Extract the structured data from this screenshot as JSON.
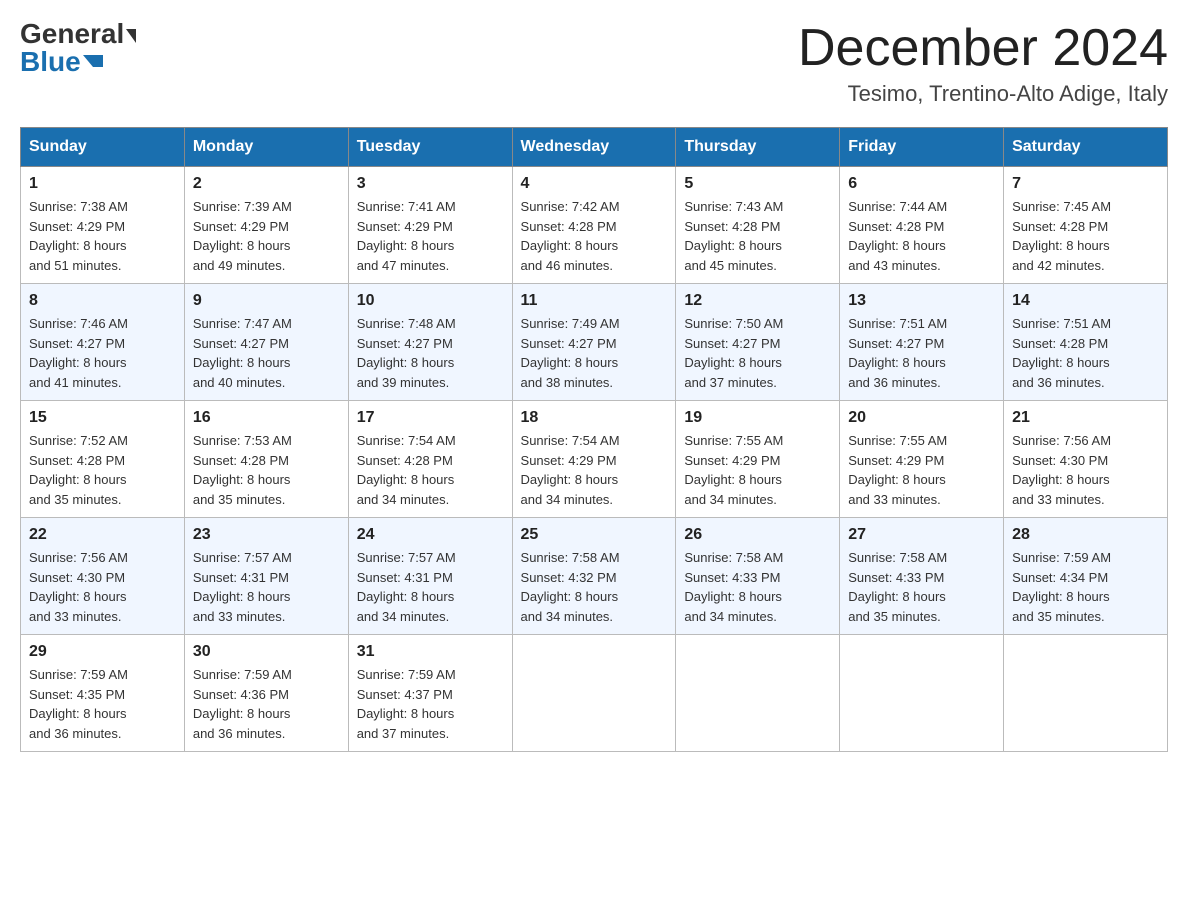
{
  "header": {
    "logo_general": "General",
    "logo_blue": "Blue",
    "month_title": "December 2024",
    "subtitle": "Tesimo, Trentino-Alto Adige, Italy"
  },
  "weekdays": [
    "Sunday",
    "Monday",
    "Tuesday",
    "Wednesday",
    "Thursday",
    "Friday",
    "Saturday"
  ],
  "weeks": [
    [
      {
        "day": "1",
        "sunrise": "7:38 AM",
        "sunset": "4:29 PM",
        "daylight": "8 hours and 51 minutes."
      },
      {
        "day": "2",
        "sunrise": "7:39 AM",
        "sunset": "4:29 PM",
        "daylight": "8 hours and 49 minutes."
      },
      {
        "day": "3",
        "sunrise": "7:41 AM",
        "sunset": "4:29 PM",
        "daylight": "8 hours and 47 minutes."
      },
      {
        "day": "4",
        "sunrise": "7:42 AM",
        "sunset": "4:28 PM",
        "daylight": "8 hours and 46 minutes."
      },
      {
        "day": "5",
        "sunrise": "7:43 AM",
        "sunset": "4:28 PM",
        "daylight": "8 hours and 45 minutes."
      },
      {
        "day": "6",
        "sunrise": "7:44 AM",
        "sunset": "4:28 PM",
        "daylight": "8 hours and 43 minutes."
      },
      {
        "day": "7",
        "sunrise": "7:45 AM",
        "sunset": "4:28 PM",
        "daylight": "8 hours and 42 minutes."
      }
    ],
    [
      {
        "day": "8",
        "sunrise": "7:46 AM",
        "sunset": "4:27 PM",
        "daylight": "8 hours and 41 minutes."
      },
      {
        "day": "9",
        "sunrise": "7:47 AM",
        "sunset": "4:27 PM",
        "daylight": "8 hours and 40 minutes."
      },
      {
        "day": "10",
        "sunrise": "7:48 AM",
        "sunset": "4:27 PM",
        "daylight": "8 hours and 39 minutes."
      },
      {
        "day": "11",
        "sunrise": "7:49 AM",
        "sunset": "4:27 PM",
        "daylight": "8 hours and 38 minutes."
      },
      {
        "day": "12",
        "sunrise": "7:50 AM",
        "sunset": "4:27 PM",
        "daylight": "8 hours and 37 minutes."
      },
      {
        "day": "13",
        "sunrise": "7:51 AM",
        "sunset": "4:27 PM",
        "daylight": "8 hours and 36 minutes."
      },
      {
        "day": "14",
        "sunrise": "7:51 AM",
        "sunset": "4:28 PM",
        "daylight": "8 hours and 36 minutes."
      }
    ],
    [
      {
        "day": "15",
        "sunrise": "7:52 AM",
        "sunset": "4:28 PM",
        "daylight": "8 hours and 35 minutes."
      },
      {
        "day": "16",
        "sunrise": "7:53 AM",
        "sunset": "4:28 PM",
        "daylight": "8 hours and 35 minutes."
      },
      {
        "day": "17",
        "sunrise": "7:54 AM",
        "sunset": "4:28 PM",
        "daylight": "8 hours and 34 minutes."
      },
      {
        "day": "18",
        "sunrise": "7:54 AM",
        "sunset": "4:29 PM",
        "daylight": "8 hours and 34 minutes."
      },
      {
        "day": "19",
        "sunrise": "7:55 AM",
        "sunset": "4:29 PM",
        "daylight": "8 hours and 34 minutes."
      },
      {
        "day": "20",
        "sunrise": "7:55 AM",
        "sunset": "4:29 PM",
        "daylight": "8 hours and 33 minutes."
      },
      {
        "day": "21",
        "sunrise": "7:56 AM",
        "sunset": "4:30 PM",
        "daylight": "8 hours and 33 minutes."
      }
    ],
    [
      {
        "day": "22",
        "sunrise": "7:56 AM",
        "sunset": "4:30 PM",
        "daylight": "8 hours and 33 minutes."
      },
      {
        "day": "23",
        "sunrise": "7:57 AM",
        "sunset": "4:31 PM",
        "daylight": "8 hours and 33 minutes."
      },
      {
        "day": "24",
        "sunrise": "7:57 AM",
        "sunset": "4:31 PM",
        "daylight": "8 hours and 34 minutes."
      },
      {
        "day": "25",
        "sunrise": "7:58 AM",
        "sunset": "4:32 PM",
        "daylight": "8 hours and 34 minutes."
      },
      {
        "day": "26",
        "sunrise": "7:58 AM",
        "sunset": "4:33 PM",
        "daylight": "8 hours and 34 minutes."
      },
      {
        "day": "27",
        "sunrise": "7:58 AM",
        "sunset": "4:33 PM",
        "daylight": "8 hours and 35 minutes."
      },
      {
        "day": "28",
        "sunrise": "7:59 AM",
        "sunset": "4:34 PM",
        "daylight": "8 hours and 35 minutes."
      }
    ],
    [
      {
        "day": "29",
        "sunrise": "7:59 AM",
        "sunset": "4:35 PM",
        "daylight": "8 hours and 36 minutes."
      },
      {
        "day": "30",
        "sunrise": "7:59 AM",
        "sunset": "4:36 PM",
        "daylight": "8 hours and 36 minutes."
      },
      {
        "day": "31",
        "sunrise": "7:59 AM",
        "sunset": "4:37 PM",
        "daylight": "8 hours and 37 minutes."
      },
      null,
      null,
      null,
      null
    ]
  ],
  "labels": {
    "sunrise": "Sunrise:",
    "sunset": "Sunset:",
    "daylight": "Daylight:"
  }
}
